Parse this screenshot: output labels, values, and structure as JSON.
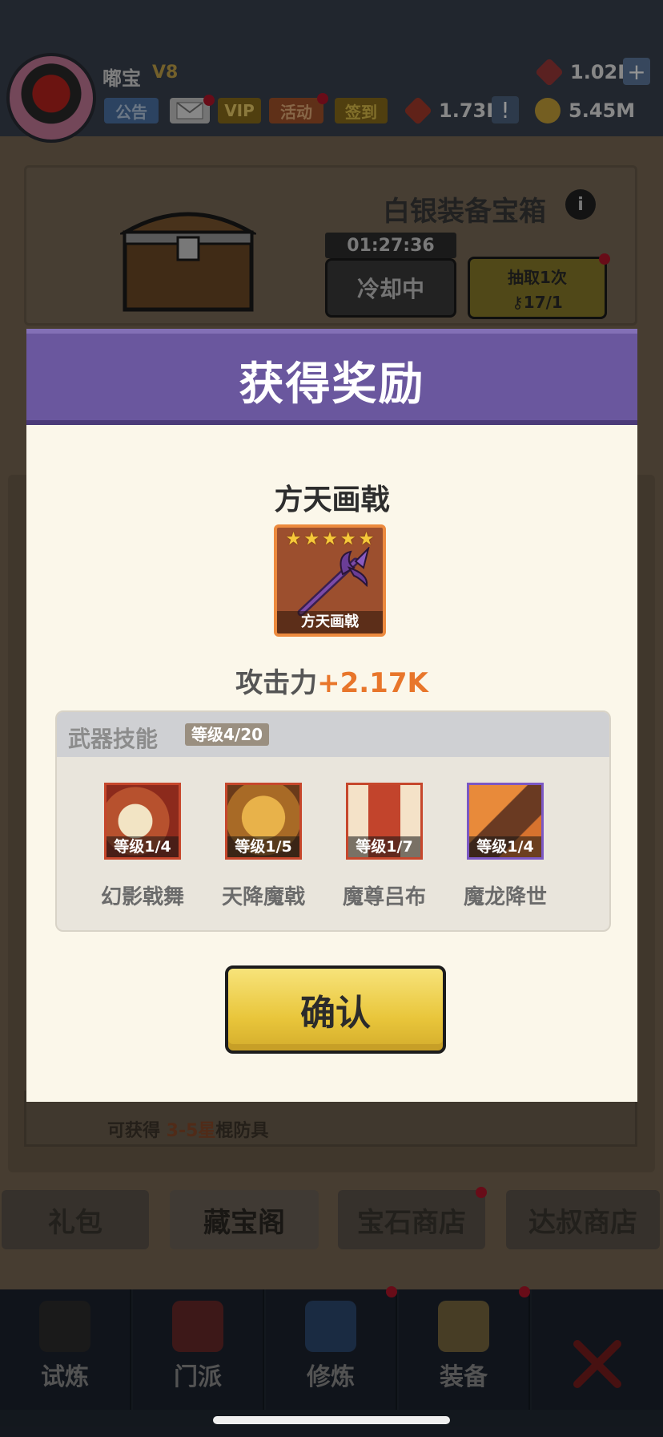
{
  "header": {
    "player_name": "嘟宝",
    "vip_tag": "V8",
    "buttons": {
      "notice": "公告",
      "vip": "VIP",
      "events": "活动",
      "checkin": "签到"
    },
    "resources": {
      "gems": "1.02K",
      "tokens": "1.73K",
      "coins": "5.45M"
    }
  },
  "chest": {
    "title": "白银装备宝箱",
    "timer": "01:27:36",
    "cooldown_label": "冷却中",
    "draw_label": "抽取1次",
    "key_count": "17/1"
  },
  "bottom_note": {
    "prefix": "可获得 ",
    "highlight": "3-5星",
    "suffix": "棍防具"
  },
  "shop_tabs": [
    "礼包",
    "藏宝阁",
    "宝石商店",
    "达叔商店"
  ],
  "nav_items": [
    "试炼",
    "门派",
    "修炼",
    "装备"
  ],
  "modal": {
    "title": "获得奖励",
    "item_name": "方天画戟",
    "item_card_label": "方天画戟",
    "stars": 5,
    "attack_label": "攻击力",
    "attack_value": "+2.17K",
    "skills_title": "武器技能",
    "skills_level": "等级4/20",
    "skills": [
      {
        "level": "等级1/4",
        "name": "幻影戟舞"
      },
      {
        "level": "等级1/5",
        "name": "天降魔戟"
      },
      {
        "level": "等级1/7",
        "name": "魔尊吕布"
      },
      {
        "level": "等级1/4",
        "name": "魔龙降世"
      }
    ],
    "confirm_label": "确认"
  },
  "colors": {
    "header_purple": "#6a579e",
    "attack_orange": "#e8762b",
    "confirm_yellow": "#e9c63b",
    "card_border_orange": "#ec8a3e",
    "skill_border_purple": "#7b58c4"
  },
  "icons": [
    "avatar",
    "mail-icon",
    "gem-icon",
    "token-icon",
    "coin-icon",
    "info-icon",
    "key-icon",
    "chest-icon",
    "halberd-icon"
  ]
}
